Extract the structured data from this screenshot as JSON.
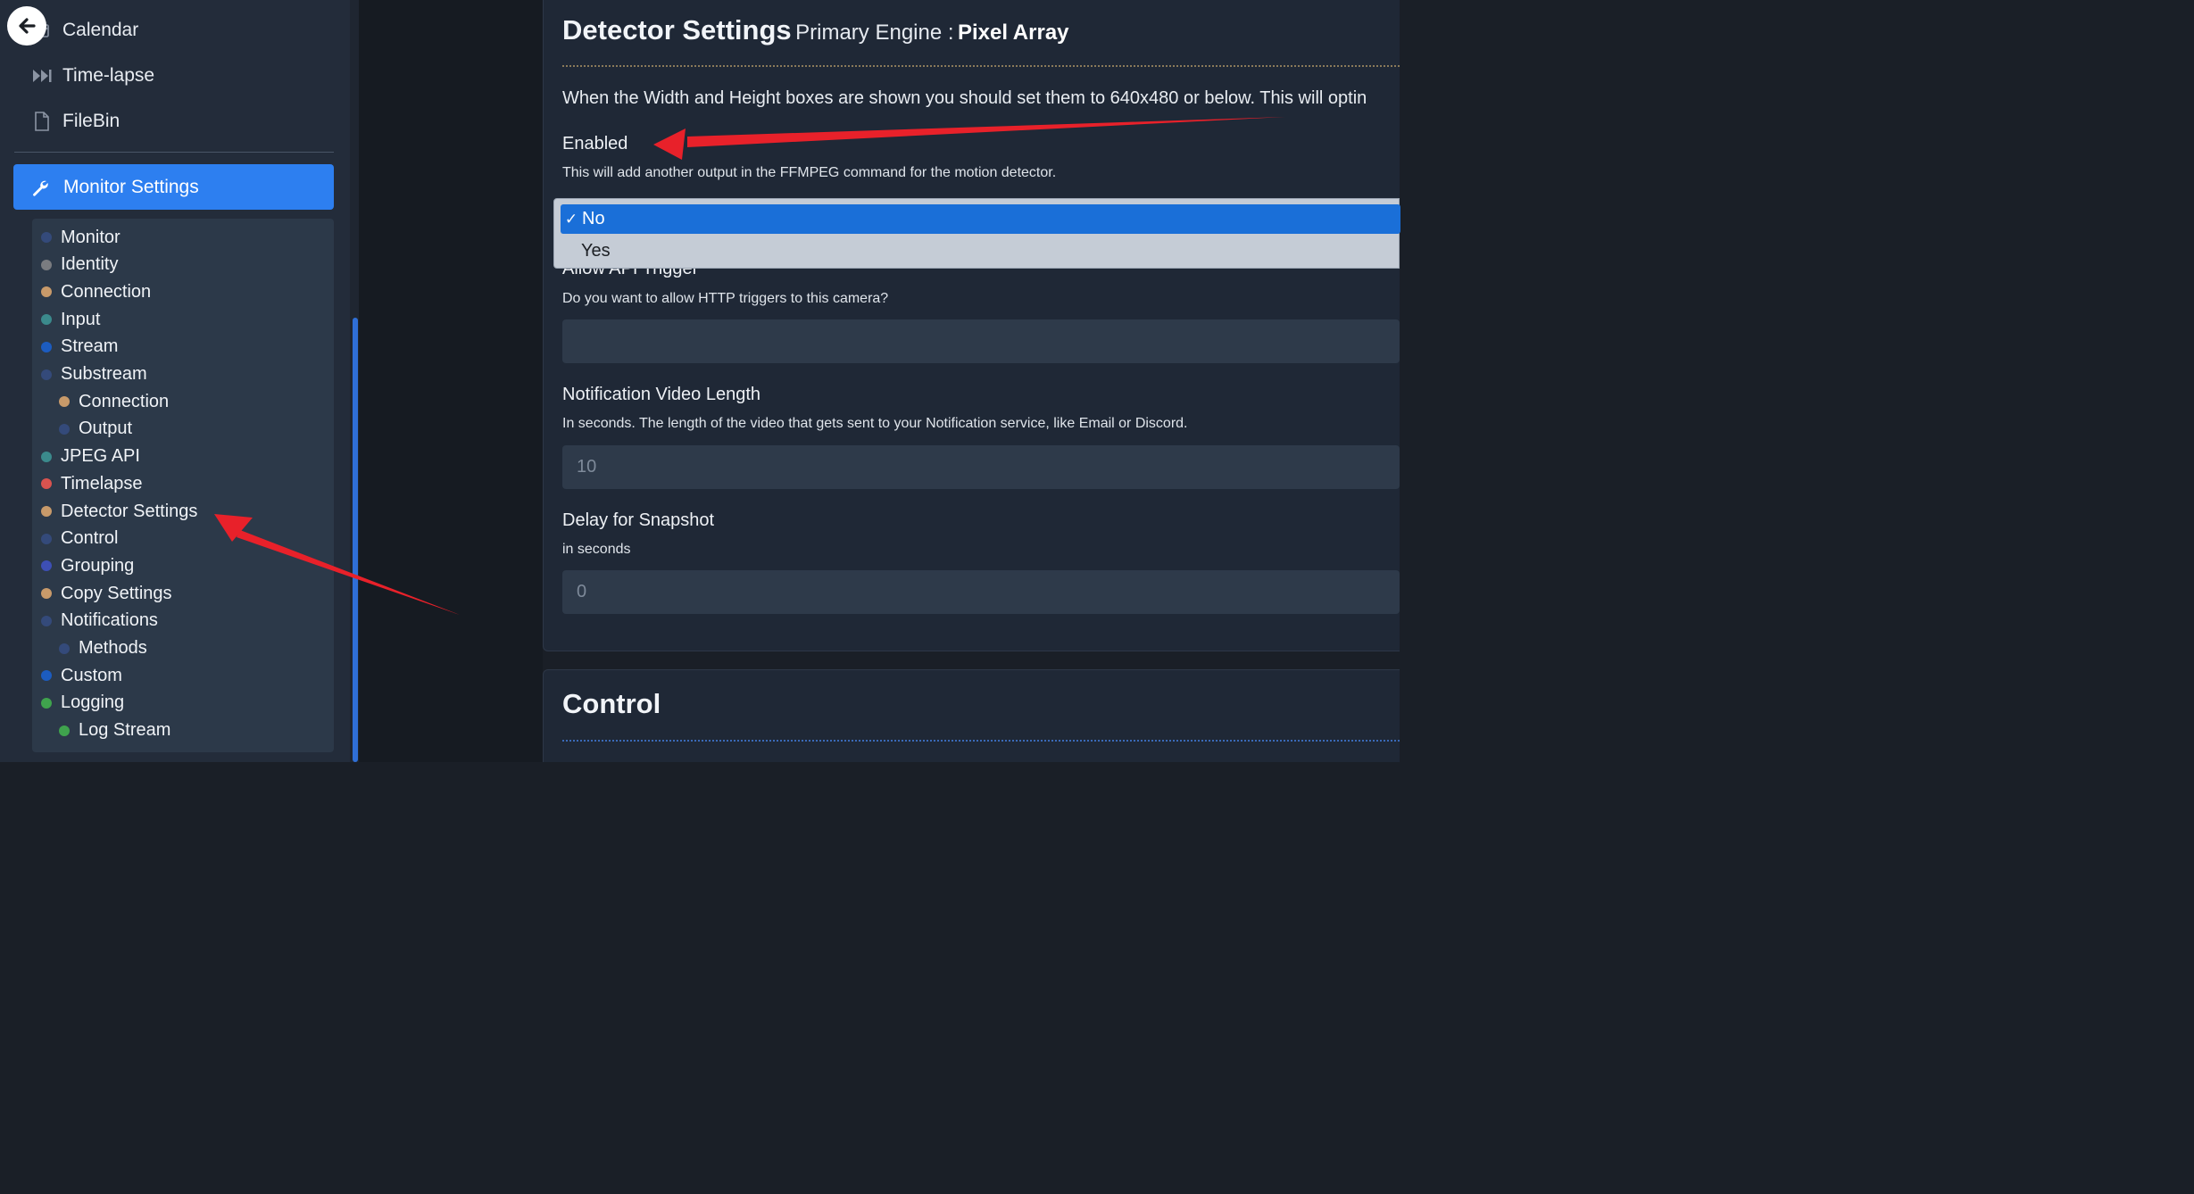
{
  "sidebar": {
    "back_icon": "arrow-left-icon",
    "top_items": [
      {
        "label": "Calendar",
        "icon": "calendar-icon"
      },
      {
        "label": "Time-lapse",
        "icon": "fast-forward-icon"
      },
      {
        "label": "FileBin",
        "icon": "file-icon"
      }
    ],
    "active": {
      "label": "Monitor Settings",
      "icon": "wrench-icon"
    },
    "submenu": [
      {
        "label": "Monitor",
        "color": "#344a7a"
      },
      {
        "label": "Identity",
        "color": "#7a7c80"
      },
      {
        "label": "Connection",
        "color": "#c89a6a"
      },
      {
        "label": "Input",
        "color": "#3b8a8c"
      },
      {
        "label": "Stream",
        "color": "#1c5cc0"
      },
      {
        "label": "Substream",
        "color": "#344a7a"
      },
      {
        "label": "Connection",
        "color": "#c89a6a",
        "sub": true
      },
      {
        "label": "Output",
        "color": "#344a7a",
        "sub": true
      },
      {
        "label": "JPEG API",
        "color": "#3b8a8c"
      },
      {
        "label": "Timelapse",
        "color": "#d9534f"
      },
      {
        "label": "Detector Settings",
        "color": "#c89a6a"
      },
      {
        "label": "Control",
        "color": "#344a7a"
      },
      {
        "label": "Grouping",
        "color": "#3d4fb5"
      },
      {
        "label": "Copy Settings",
        "color": "#c89a6a"
      },
      {
        "label": "Notifications",
        "color": "#344a7a"
      },
      {
        "label": "Methods",
        "color": "#344a7a",
        "sub": true
      },
      {
        "label": "Custom",
        "color": "#1c5cc0"
      },
      {
        "label": "Logging",
        "color": "#3fa34d"
      },
      {
        "label": "Log Stream",
        "color": "#3fa34d",
        "sub": true
      }
    ]
  },
  "main": {
    "title": "Detector Settings",
    "subtitle_prefix": "Primary Engine :",
    "engine": "Pixel Array",
    "intro": "When the Width and Height boxes are shown you should set them to 640x480 or below. This will optin",
    "enabled": {
      "label": "Enabled",
      "desc": "This will add another output in the FFMPEG command for the motion detector.",
      "options": [
        "No",
        "Yes"
      ],
      "selected": "No",
      "check": "✓"
    },
    "api_trigger": {
      "label": "Allow API Trigger",
      "desc": "Do you want to allow HTTP triggers to this camera?",
      "value": ""
    },
    "notif_length": {
      "label": "Notification Video Length",
      "desc": "In seconds. The length of the video that gets sent to your Notification service, like Email or Discord.",
      "value": "10"
    },
    "snapshot_delay": {
      "label": "Delay for Snapshot",
      "desc": "in seconds",
      "value": "0"
    },
    "control_title": "Control"
  },
  "colors": {
    "accent": "#2d7ff0",
    "annotation": "#e8212a"
  }
}
